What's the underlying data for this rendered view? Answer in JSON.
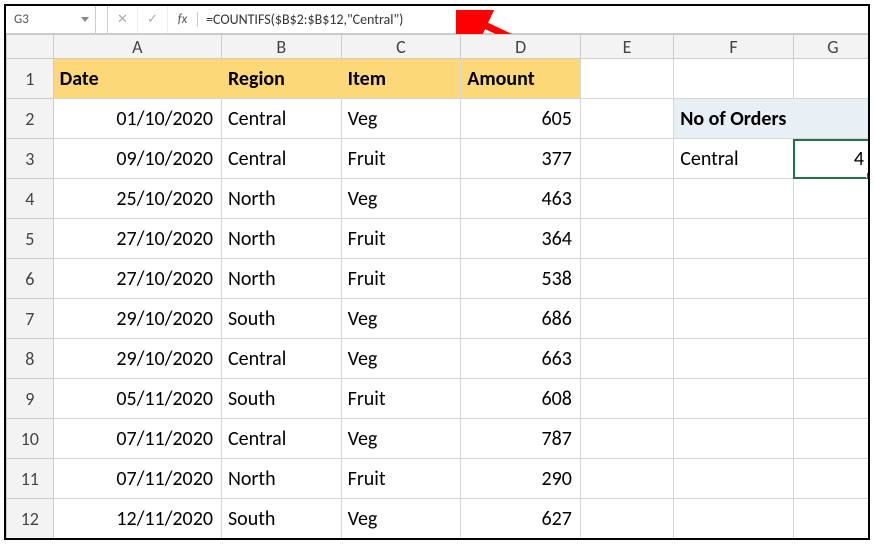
{
  "formula_bar": {
    "name_box": "G3",
    "cancel": "✕",
    "confirm": "✓",
    "fx": "fx",
    "formula": "=COUNTIFS($B$2:$B$12,\"Central\")"
  },
  "cols": {
    "A": "A",
    "B": "B",
    "C": "C",
    "D": "D",
    "E": "E",
    "F": "F",
    "G": "G"
  },
  "row_nums": [
    "1",
    "2",
    "3",
    "4",
    "5",
    "6",
    "7",
    "8",
    "9",
    "10",
    "11",
    "12"
  ],
  "headers": {
    "date": "Date",
    "region": "Region",
    "item": "Item",
    "amount": "Amount"
  },
  "side": {
    "title": "No of Orders",
    "label": "Central",
    "value": "4"
  },
  "rows": [
    {
      "date": "01/10/2020",
      "region": "Central",
      "item": "Veg",
      "amount": "605"
    },
    {
      "date": "09/10/2020",
      "region": "Central",
      "item": "Fruit",
      "amount": "377"
    },
    {
      "date": "25/10/2020",
      "region": "North",
      "item": "Veg",
      "amount": "463"
    },
    {
      "date": "27/10/2020",
      "region": "North",
      "item": "Fruit",
      "amount": "364"
    },
    {
      "date": "27/10/2020",
      "region": "North",
      "item": "Fruit",
      "amount": "538"
    },
    {
      "date": "29/10/2020",
      "region": "South",
      "item": "Veg",
      "amount": "686"
    },
    {
      "date": "29/10/2020",
      "region": "Central",
      "item": "Veg",
      "amount": "663"
    },
    {
      "date": "05/11/2020",
      "region": "South",
      "item": "Fruit",
      "amount": "608"
    },
    {
      "date": "07/11/2020",
      "region": "Central",
      "item": "Veg",
      "amount": "787"
    },
    {
      "date": "07/11/2020",
      "region": "North",
      "item": "Fruit",
      "amount": "290"
    },
    {
      "date": "12/11/2020",
      "region": "South",
      "item": "Veg",
      "amount": "627"
    }
  ],
  "chart_data": {
    "type": "table",
    "title": "Orders data with COUNTIFS on Region=Central",
    "columns": [
      "Date",
      "Region",
      "Item",
      "Amount"
    ],
    "data": [
      [
        "01/10/2020",
        "Central",
        "Veg",
        605
      ],
      [
        "09/10/2020",
        "Central",
        "Fruit",
        377
      ],
      [
        "25/10/2020",
        "North",
        "Veg",
        463
      ],
      [
        "27/10/2020",
        "North",
        "Fruit",
        364
      ],
      [
        "27/10/2020",
        "North",
        "Fruit",
        538
      ],
      [
        "29/10/2020",
        "South",
        "Veg",
        686
      ],
      [
        "29/10/2020",
        "Central",
        "Veg",
        663
      ],
      [
        "05/11/2020",
        "South",
        "Fruit",
        608
      ],
      [
        "07/11/2020",
        "Central",
        "Veg",
        787
      ],
      [
        "07/11/2020",
        "North",
        "Fruit",
        290
      ],
      [
        "12/11/2020",
        "South",
        "Veg",
        627
      ]
    ],
    "summary": {
      "label": "No of Orders (Central)",
      "value": 4
    }
  }
}
